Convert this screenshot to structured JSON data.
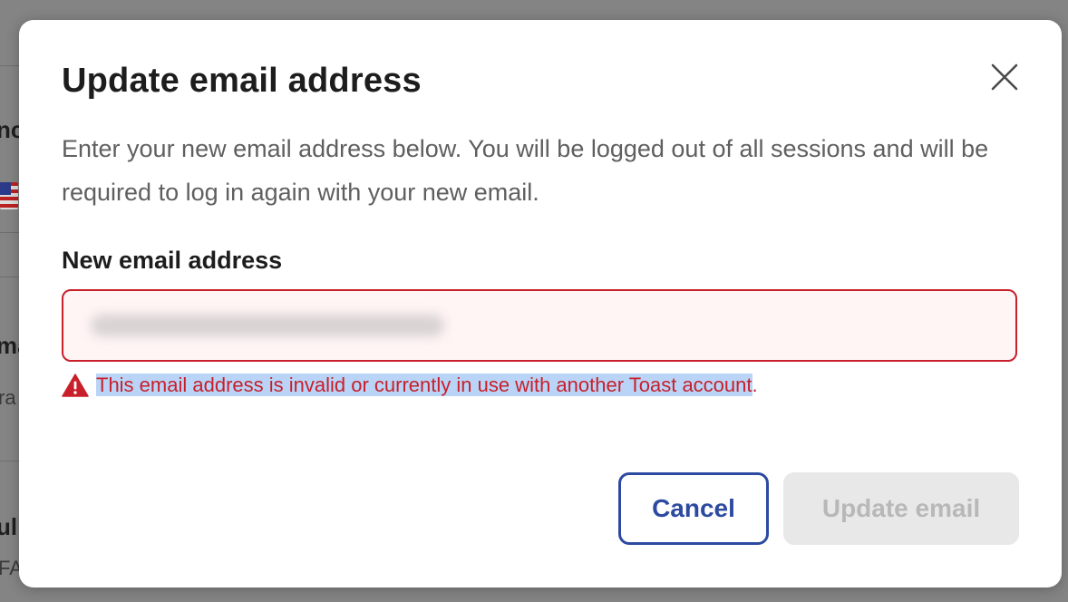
{
  "background": {
    "fragments": [
      "nc",
      "ma",
      "ra",
      "ul",
      "FA"
    ]
  },
  "modal": {
    "title": "Update email address",
    "description": "Enter your new email address below. You will be logged out of all sessions and will be required to log in again with your new email.",
    "field_label": "New email address",
    "email_value": "",
    "error_selected": "This email address is invalid or currently in use with another Toast account",
    "error_tail": ".",
    "cancel_label": "Cancel",
    "update_label": "Update email"
  },
  "colors": {
    "error": "#c8202b",
    "primary": "#2c4aa0",
    "disabled_bg": "#e8e8e8",
    "disabled_text": "#b8b8b8"
  },
  "icons": [
    "close-icon",
    "warning-icon",
    "flag-icon"
  ]
}
